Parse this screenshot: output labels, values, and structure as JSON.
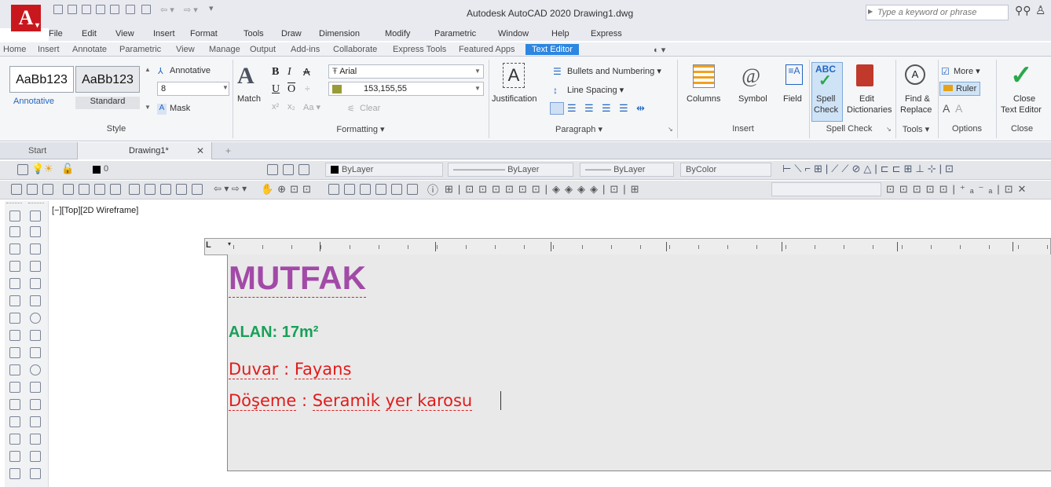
{
  "window": {
    "title": "Autodesk AutoCAD 2020   Drawing1.dwg"
  },
  "search": {
    "placeholder": "Type a keyword or phrase"
  },
  "menu": [
    "File",
    "Edit",
    "View",
    "Insert",
    "Format",
    "Tools",
    "Draw",
    "Dimension",
    "Modify",
    "Parametric",
    "Window",
    "Help",
    "Express"
  ],
  "ribbon_tabs": [
    "Home",
    "Insert",
    "Annotate",
    "Parametric",
    "View",
    "Manage",
    "Output",
    "Add-ins",
    "Collaborate",
    "Express Tools",
    "Featured Apps",
    "Text Editor"
  ],
  "style_panel": {
    "style1": "AaBb123",
    "style1_label": "Annotative",
    "style2": "AaBb123",
    "style2_label": "Standard",
    "annotative": "Annotative",
    "height": "8",
    "mask": "Mask",
    "title": "Style"
  },
  "formatting_panel": {
    "match": "Match",
    "font": "Arial",
    "color": "153,155,55",
    "clear": "Clear",
    "title": "Formatting"
  },
  "paragraph_panel": {
    "justification": "Justification",
    "bullets": "Bullets and Numbering",
    "line_spacing": "Line Spacing",
    "title": "Paragraph"
  },
  "insert_panel": {
    "columns": "Columns",
    "symbol": "Symbol",
    "field": "Field",
    "title": "Insert"
  },
  "spell_panel": {
    "spell": "Spell",
    "check": "Check",
    "abc": "ABC",
    "edit": "Edit",
    "dictionaries": "Dictionaries",
    "title": "Spell Check"
  },
  "tools_panel": {
    "find": "Find &",
    "replace": "Replace",
    "title": "Tools"
  },
  "options_panel": {
    "more": "More",
    "ruler": "Ruler",
    "title": "Options"
  },
  "close_panel": {
    "close": "Close",
    "text_editor": "Text Editor",
    "title": "Close"
  },
  "doc_tabs": {
    "start": "Start",
    "drawing": "Drawing1*"
  },
  "layer_toolbar": {
    "layer": "0",
    "color": "ByLayer",
    "linetype": "ByLayer",
    "lineweight": "ByLayer",
    "plotstyle": "ByColor"
  },
  "viewport": {
    "label": "[−][Top][2D Wireframe]"
  },
  "text_content": {
    "line1": "MUTFAK",
    "line2": "ALAN:  17m²",
    "line3_a": "Duvar",
    "line3_b": " : ",
    "line3_c": "Fayans",
    "line4_a": "Döşeme",
    "line4_b": " : ",
    "line4_c": "Seramik",
    "line4_d": " ",
    "line4_e": "yer",
    "line4_f": " ",
    "line4_g": "karosu"
  },
  "colors": {
    "accent": "#2d86e0",
    "magenta_text": "#a24aa8",
    "green_text": "#18a058",
    "red_text": "#e11b1b"
  }
}
